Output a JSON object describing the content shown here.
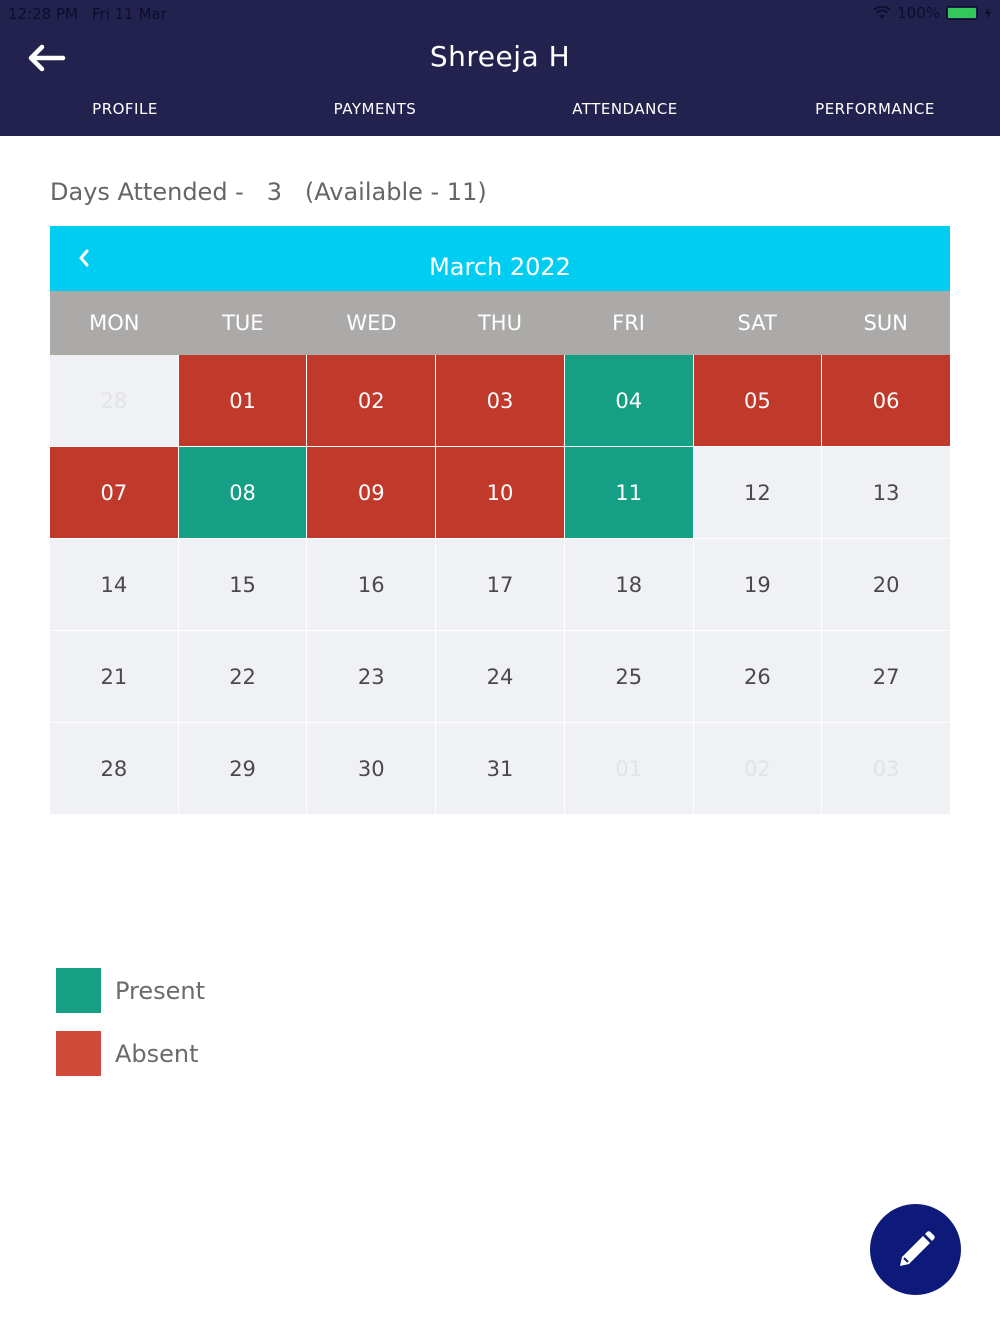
{
  "status_bar": {
    "time": "12:28 PM",
    "date": "Fri 11 Mar",
    "battery": "100%"
  },
  "header": {
    "title": "Shreeja H",
    "tabs": [
      "PROFILE",
      "PAYMENTS",
      "ATTENDANCE",
      "PERFORMANCE"
    ]
  },
  "summary": {
    "text": "Days Attended -   3   (Available - 11)"
  },
  "calendar": {
    "month_label": "March 2022",
    "weekdays": [
      "MON",
      "TUE",
      "WED",
      "THU",
      "FRI",
      "SAT",
      "SUN"
    ],
    "days": [
      {
        "label": "28",
        "state": "outside"
      },
      {
        "label": "01",
        "state": "absent"
      },
      {
        "label": "02",
        "state": "absent"
      },
      {
        "label": "03",
        "state": "absent"
      },
      {
        "label": "04",
        "state": "present"
      },
      {
        "label": "05",
        "state": "absent"
      },
      {
        "label": "06",
        "state": "absent"
      },
      {
        "label": "07",
        "state": "absent"
      },
      {
        "label": "08",
        "state": "present"
      },
      {
        "label": "09",
        "state": "absent"
      },
      {
        "label": "10",
        "state": "absent"
      },
      {
        "label": "11",
        "state": "present"
      },
      {
        "label": "12",
        "state": "none"
      },
      {
        "label": "13",
        "state": "none"
      },
      {
        "label": "14",
        "state": "none"
      },
      {
        "label": "15",
        "state": "none"
      },
      {
        "label": "16",
        "state": "none"
      },
      {
        "label": "17",
        "state": "none"
      },
      {
        "label": "18",
        "state": "none"
      },
      {
        "label": "19",
        "state": "none"
      },
      {
        "label": "20",
        "state": "none"
      },
      {
        "label": "21",
        "state": "none"
      },
      {
        "label": "22",
        "state": "none"
      },
      {
        "label": "23",
        "state": "none"
      },
      {
        "label": "24",
        "state": "none"
      },
      {
        "label": "25",
        "state": "none"
      },
      {
        "label": "26",
        "state": "none"
      },
      {
        "label": "27",
        "state": "none"
      },
      {
        "label": "28",
        "state": "none"
      },
      {
        "label": "29",
        "state": "none"
      },
      {
        "label": "30",
        "state": "none"
      },
      {
        "label": "31",
        "state": "none"
      },
      {
        "label": "01",
        "state": "outside"
      },
      {
        "label": "02",
        "state": "outside"
      },
      {
        "label": "03",
        "state": "outside"
      }
    ]
  },
  "legend": [
    {
      "label": "Present",
      "color": "#15a085"
    },
    {
      "label": "Absent",
      "color": "#d04b39"
    }
  ],
  "colors": {
    "header_bg": "#23224f",
    "calendar_header": "#00cdf2",
    "present": "#15a085",
    "absent": "#c0392b",
    "fab": "#0e1a7a"
  },
  "icons": {
    "back": "arrow-left-icon",
    "prev_month": "chevron-left-icon",
    "fab": "pencil-icon"
  }
}
